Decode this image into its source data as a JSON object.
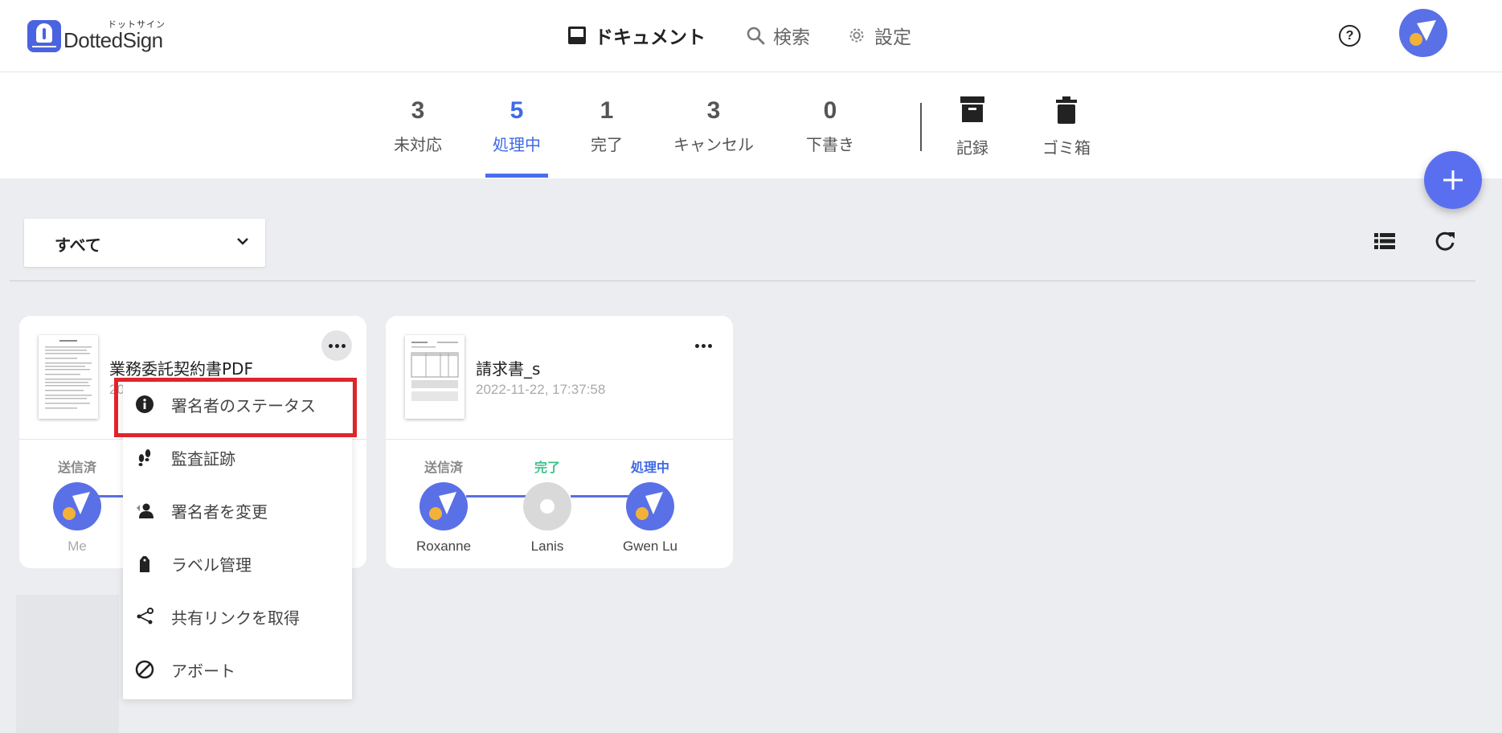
{
  "app": {
    "logo_text": "DottedSign",
    "logo_ruby": "ドットサイン"
  },
  "nav": {
    "documents": "ドキュメント",
    "search": "検索",
    "settings": "設定"
  },
  "tabs": [
    {
      "count": "3",
      "label": "未対応"
    },
    {
      "count": "5",
      "label": "処理中"
    },
    {
      "count": "1",
      "label": "完了"
    },
    {
      "count": "3",
      "label": "キャンセル"
    },
    {
      "count": "0",
      "label": "下書き"
    }
  ],
  "archive_tabs": [
    {
      "label": "記録"
    },
    {
      "label": "ゴミ箱"
    }
  ],
  "filter": {
    "value": "すべて"
  },
  "cards": [
    {
      "title": "業務委託契約書PDF",
      "date": "20",
      "steps": [
        {
          "status": "送信済",
          "name": "Me"
        }
      ]
    },
    {
      "title": "請求書_s",
      "date": "2022-11-22, 17:37:58",
      "steps": [
        {
          "status": "送信済",
          "name": "Roxanne"
        },
        {
          "status": "完了",
          "name": "Lanis"
        },
        {
          "status": "処理中",
          "name": "Gwen Lu"
        }
      ]
    }
  ],
  "menu": {
    "items": [
      {
        "label": "署名者のステータス",
        "icon": "info-icon"
      },
      {
        "label": "監査証跡",
        "icon": "footprints-icon"
      },
      {
        "label": "署名者を変更",
        "icon": "change-user-icon"
      },
      {
        "label": "ラベル管理",
        "icon": "tag-icon"
      },
      {
        "label": "共有リンクを取得",
        "icon": "share-icon"
      },
      {
        "label": "アボート",
        "icon": "abort-icon"
      }
    ]
  },
  "colors": {
    "accent": "#3f6ae6",
    "brand": "#5a70e6",
    "done": "#3cc28b",
    "highlight": "#e0242b",
    "avatar_dot": "#f2b23a"
  }
}
